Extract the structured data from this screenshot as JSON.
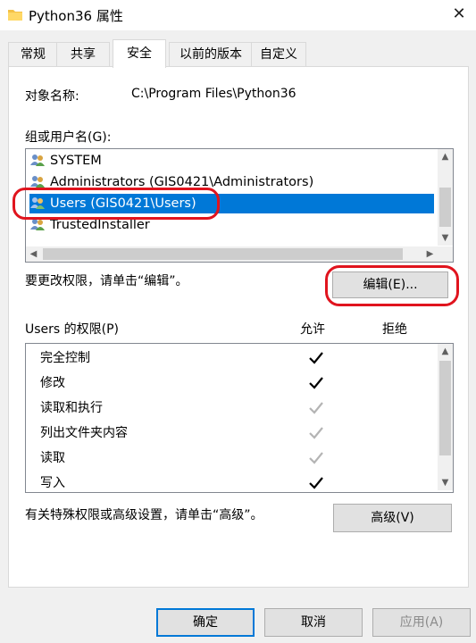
{
  "window": {
    "title": "Python36 属性",
    "close_glyph": "✕"
  },
  "tabs": [
    {
      "label": "常规"
    },
    {
      "label": "共享"
    },
    {
      "label": "安全",
      "active": true
    },
    {
      "label": "以前的版本"
    },
    {
      "label": "自定义"
    }
  ],
  "security": {
    "object_name_label": "对象名称:",
    "object_name_value": "C:\\Program Files\\Python36",
    "group_label": "组或用户名(G):",
    "users": [
      {
        "name": "SYSTEM",
        "icon": "users-group-icon"
      },
      {
        "name": "Administrators (GIS0421\\Administrators)",
        "icon": "users-group-icon"
      },
      {
        "name": "Users (GIS0421\\Users)",
        "icon": "users-group-icon",
        "selected": true
      },
      {
        "name": "TrustedInstaller",
        "icon": "users-group-icon"
      }
    ],
    "edit_hint": "要更改权限，请单击“编辑”。",
    "edit_button": "编辑(E)...",
    "perm_header": "Users 的权限(P)",
    "allow_header": "允许",
    "deny_header": "拒绝",
    "permissions": [
      {
        "name": "完全控制",
        "allow": "checked"
      },
      {
        "name": "修改",
        "allow": "checked"
      },
      {
        "name": "读取和执行",
        "allow": "inherited"
      },
      {
        "name": "列出文件夹内容",
        "allow": "inherited"
      },
      {
        "name": "读取",
        "allow": "inherited"
      },
      {
        "name": "写入",
        "allow": "checked"
      }
    ],
    "advanced_hint": "有关特殊权限或高级设置，请单击“高级”。",
    "advanced_button": "高级(V)"
  },
  "footer": {
    "ok": "确定",
    "cancel": "取消",
    "apply": "应用(A)"
  },
  "colors": {
    "selection": "#0078d7",
    "annotation": "#e0141e"
  }
}
